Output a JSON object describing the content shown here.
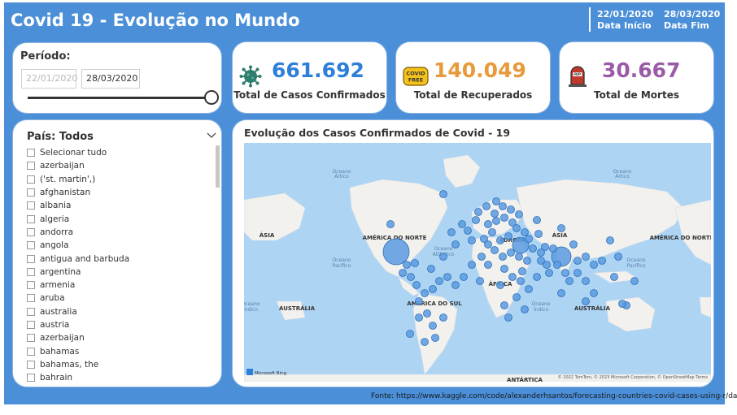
{
  "header": {
    "title": "Covid 19 - Evolução no Mundo",
    "start_date": "22/01/2020",
    "start_label": "Data Início",
    "end_date": "28/03/2020",
    "end_label": "Data Fim"
  },
  "periodo": {
    "label": "Período:",
    "start_value": "22/01/2020",
    "end_value": "28/03/2020",
    "slider_position": 1.0
  },
  "kpis": {
    "confirmed": {
      "value": "661.692",
      "label": "Total de Casos Confirmados",
      "color": "#2e7fd8",
      "icon": "virus-icon"
    },
    "recovered": {
      "value": "140.049",
      "label": "Total de Recuperados",
      "color": "#e89a3a",
      "icon": "covid-free-badge-icon",
      "badge_text": "COVID FREE"
    },
    "deaths": {
      "value": "30.667",
      "label": "Total de Mortes",
      "color": "#9b5aa8",
      "icon": "tombstone-icon",
      "badge_text": "RIP"
    }
  },
  "country_filter": {
    "title": "País: Todos",
    "items": [
      "Selecionar tudo",
      "azerbaijan",
      "('st. martin',)",
      "afghanistan",
      "albania",
      "algeria",
      "andorra",
      "angola",
      "antigua and barbuda",
      "argentina",
      "armenia",
      "aruba",
      "australia",
      "austria",
      "azerbaijan",
      "bahamas",
      "bahamas, the",
      "bahrain"
    ]
  },
  "map": {
    "title": "Evolução dos Casos Confirmados de Covid - 19",
    "labels": {
      "ocean_artico_1": "Oceano Ártico",
      "ocean_artico_2": "Oceano Ártico",
      "asia_left": "ÁSIA",
      "asia_right": "ÁSIA",
      "america_norte_1": "AMÉRICA DO NORTE",
      "america_norte_2": "AMÉRICA DO NORTE",
      "europa": "EUROPA",
      "africa": "ÁFRICA",
      "ocean_atlantico": "Oceano Atlântico",
      "ocean_pacifico_1": "Oceano Pacífico",
      "ocean_pacifico_2": "Oceano Pacífico",
      "australia_left": "AUSTRÁLIA",
      "australia_right": "AUSTRÁLIA",
      "america_sul": "AMÉRICA DO SUL",
      "ocean_indico": "Oceano Índico",
      "ocean_indico_left": "Oceano Índico",
      "antartica": "ANTÁRTICA",
      "attribution": "© 2022 TomTom, © 2023 Microsoft Corporation, © OpenStreetMap  Terms",
      "bing": "Microsoft Bing"
    },
    "colors": {
      "water": "#aed4f4",
      "land": "#f2f1ee",
      "bubble": "#5b9be0",
      "bubble_stroke": "#2e6fb8"
    }
  },
  "source": {
    "label": "Fonte:",
    "url": "https://www.kaggle.com/code/alexanderhsantos/forecasting-countries-covid-cases-using-r/data"
  }
}
